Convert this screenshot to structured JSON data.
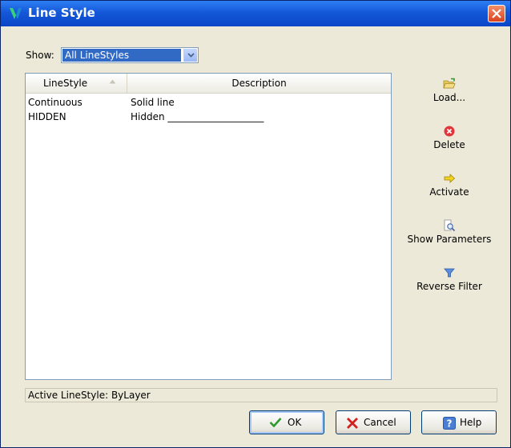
{
  "window": {
    "title": "Line Style"
  },
  "filter": {
    "label": "Show:",
    "selected": "All LineStyles"
  },
  "table": {
    "columns": [
      "LineStyle",
      "Description"
    ],
    "rows": [
      {
        "name": "Continuous",
        "description": "Solid line"
      },
      {
        "name": "HIDDEN",
        "description": "Hidden ____________________"
      }
    ]
  },
  "side_buttons": {
    "load": "Load...",
    "delete": "Delete",
    "activate": "Activate",
    "show_parameters": "Show Parameters",
    "reverse_filter": "Reverse Filter"
  },
  "status": {
    "text": "Active LineStyle: ByLayer"
  },
  "buttons": {
    "ok": "OK",
    "cancel": "Cancel",
    "help": "Help"
  },
  "colors": {
    "titlebar": "#0a45c8",
    "selection": "#316ac5",
    "ok_green": "#2e9a2e",
    "cancel_red": "#d21f1f"
  }
}
